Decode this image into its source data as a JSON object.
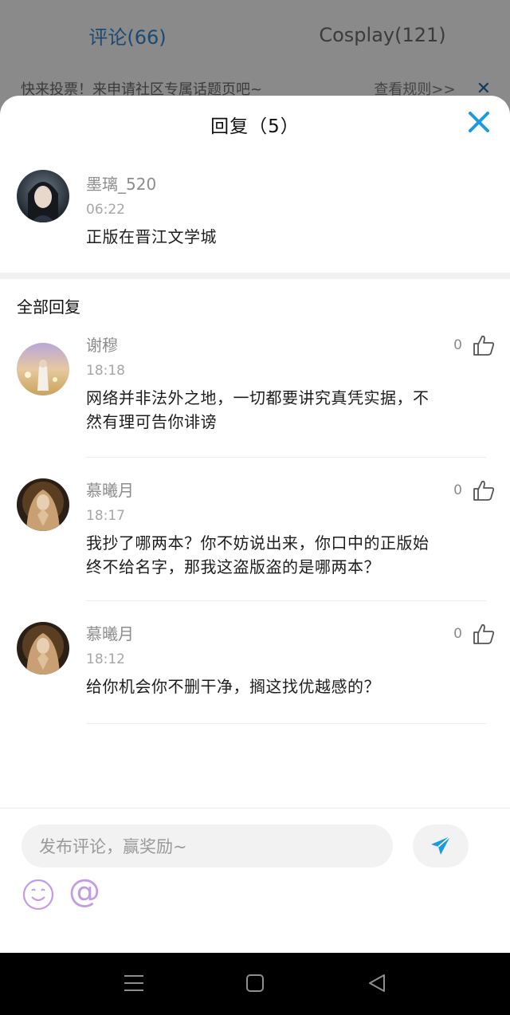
{
  "background": {
    "tabs": [
      {
        "label": "评论(66)",
        "active": true
      },
      {
        "label": "Cosplay(121)",
        "active": false
      }
    ],
    "banner": {
      "text": "快来投票！来申请社区专属话题页吧~",
      "rules_link": "查看规则>>",
      "close_icon": "close-icon"
    }
  },
  "sheet": {
    "title": "回复（5）",
    "close_icon": "close-icon",
    "main_comment": {
      "username": "墨璃_520",
      "time": "06:22",
      "content": "正版在晋江文学城"
    },
    "all_replies_title": "全部回复",
    "replies": [
      {
        "username": "谢穆",
        "time": "18:18",
        "content_lines": [
          "网络并非法外之地，一切都要讲究真凭实据，不",
          "然有理可告你诽谤"
        ],
        "likes": "0"
      },
      {
        "username": "慕曦月",
        "time": "18:17",
        "content_lines": [
          "我抄了哪两本？你不妨说出来，你口中的正版始",
          "终不给名字，那我这盗版盗的是哪两本？"
        ],
        "likes": "0"
      },
      {
        "username": "慕曦月",
        "time": "18:12",
        "content_lines": [
          "给你机会你不删干净，搁这找优越感的？"
        ],
        "likes": "0"
      }
    ]
  },
  "input_bar": {
    "placeholder": "发布评论，赢奖励~",
    "send_icon": "send-icon",
    "emoji_icon": "emoji-icon",
    "at_symbol": "@"
  },
  "nav_bar": {
    "icons": [
      "menu-icon",
      "home-icon",
      "back-icon"
    ]
  },
  "colors": {
    "accent_blue": "#1a9be0",
    "active_tab": "#1b4a72",
    "emoji_purple": "#c39be6"
  }
}
